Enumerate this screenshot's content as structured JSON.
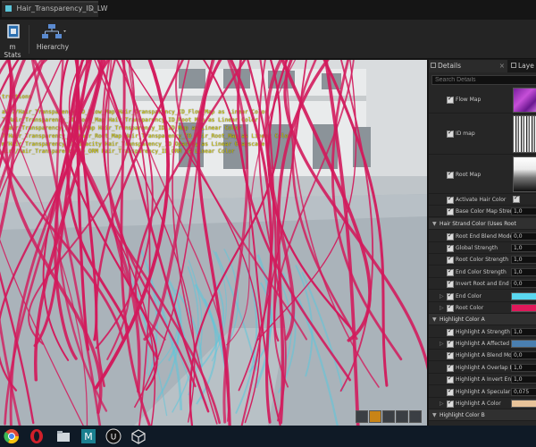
{
  "tab": {
    "title": "Hair_Transparency_ID_LW",
    "close": "×"
  },
  "toolbar": {
    "stats_label": "m Stats",
    "hierarchy_label": "Hierarchy"
  },
  "viewport": {
    "log_lines": [
      "tructions",
      "air7/Hair_Transparency_ID_Flow_Map Hair_Transparency_ID_Flow_Map as Linear Color",
      "7/Hair_Transparency_ID_Root_Map Hair_Transparency_ID_Root_Map as Linear Color",
      "/Hair_Transparency_ID_ID_Map Hair_Transparency_ID_ID_Map as Linear Color",
      "7/Hair_Transparency_ID_Hair_Root_Map Hair_Transparency_ID_Hair_Root_Map as Linear Color",
      "m/Hair_Transparency_ID_Opacity Hair_Transparency_ID_Opacity as Linear Grayscale",
      "air7/Hair_Transparency_ID_ORM Hair_Transparency_ID_ORM as Linear Color"
    ]
  },
  "panel": {
    "details_tab": "Details",
    "layers_tab": "Laye",
    "search_placeholder": "Search Details",
    "textures": [
      {
        "label": "Flow Map"
      },
      {
        "label": "ID map"
      },
      {
        "label": "Root Map"
      }
    ],
    "rows_top": [
      {
        "label": "Activate Hair Color",
        "kind": "check"
      },
      {
        "label": "Base Color Map Streng",
        "kind": "value",
        "value": "1,0"
      }
    ],
    "category_1": "Hair Strand Color (Uses Root",
    "rows_hair": [
      {
        "label": "Root End Blend Mode",
        "kind": "value",
        "value": "0,0"
      },
      {
        "label": "Global Strength",
        "kind": "value",
        "value": "1,0"
      },
      {
        "label": "Root Color Strength",
        "kind": "value",
        "value": "1,0"
      },
      {
        "label": "End Color Strength",
        "kind": "value",
        "value": "1,0"
      },
      {
        "label": "Invert Root and End Col",
        "kind": "value",
        "value": "0,0"
      },
      {
        "label": "End Color",
        "kind": "swatch",
        "color": "#5ad8f0",
        "expand": true
      },
      {
        "label": "Root Color",
        "kind": "swatch",
        "color": "#e0185a",
        "expand": true
      }
    ],
    "category_2": "Highlight Color A",
    "rows_highlight": [
      {
        "label": "Highlight A Strength",
        "kind": "value",
        "value": "1,0"
      },
      {
        "label": "Highlight A Affected Ra",
        "kind": "swatch",
        "color": "#4a7fb0",
        "expand": true
      },
      {
        "label": "Highlight A Blend Mode",
        "kind": "value",
        "value": "0,0"
      },
      {
        "label": "Highlight A Overlap End",
        "kind": "value",
        "value": "1,0"
      },
      {
        "label": "Highlight A Invert End t",
        "kind": "value",
        "value": "1,0"
      },
      {
        "label": "Highlight A Specular St",
        "kind": "value",
        "value": "0,075"
      },
      {
        "label": "Highlight A Color",
        "kind": "swatch",
        "color": "#e8c39a",
        "expand": true
      }
    ],
    "category_3": "Highlight Color B"
  },
  "colors": {
    "hair_main": "#d21a5c",
    "hair_tips": "#5ac6dc",
    "log_text": "#d8d000",
    "accent_orange": "#c98416"
  }
}
